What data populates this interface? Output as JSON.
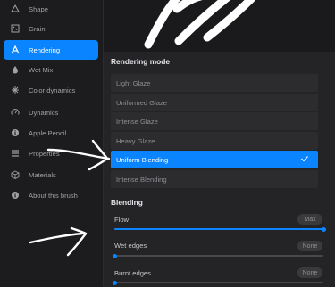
{
  "sidebar": {
    "items": [
      {
        "label": "Shape",
        "icon": "shape-icon"
      },
      {
        "label": "Grain",
        "icon": "grain-icon"
      },
      {
        "label": "Rendering",
        "icon": "rendering-icon",
        "active": true
      },
      {
        "label": "Wet Mix",
        "icon": "droplet-icon"
      },
      {
        "label": "Color dynamics",
        "icon": "color-dynamics-icon"
      },
      {
        "label": "Dynamics",
        "icon": "speedometer-icon"
      },
      {
        "label": "Apple Pencil",
        "icon": "info-icon"
      },
      {
        "label": "Properties",
        "icon": "list-icon"
      },
      {
        "label": "Materials",
        "icon": "cube-icon"
      },
      {
        "label": "About this brush",
        "icon": "info-icon"
      }
    ]
  },
  "rendering": {
    "title": "Rendering mode",
    "options": [
      {
        "label": "Light Glaze"
      },
      {
        "label": "Uniformed Glaze"
      },
      {
        "label": "Intense Glaze"
      },
      {
        "label": "Heavy Glaze"
      },
      {
        "label": "Uniform Blending",
        "selected": true
      },
      {
        "label": "Intense Blending"
      }
    ]
  },
  "blending": {
    "title": "Blending",
    "sliders": [
      {
        "label": "Flow",
        "value_text": "Max",
        "fraction": 1.0
      },
      {
        "label": "Wet edges",
        "value_text": "None",
        "fraction": 0.0
      },
      {
        "label": "Burnt edges",
        "value_text": "None",
        "fraction": 0.0
      }
    ]
  },
  "colors": {
    "accent": "#0a84ff",
    "background": "#242426"
  }
}
